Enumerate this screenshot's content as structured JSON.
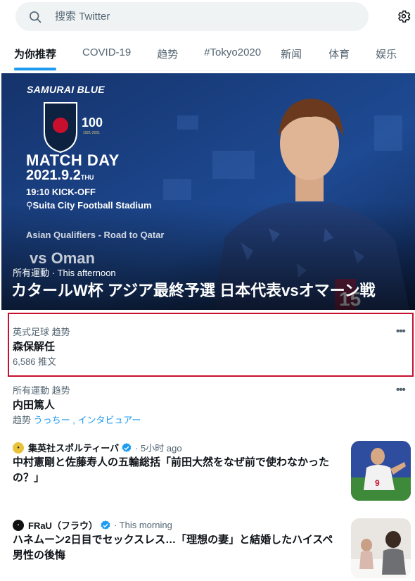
{
  "search": {
    "placeholder": "搜索 Twitter"
  },
  "tabs": [
    {
      "label": "为你推荐",
      "active": true
    },
    {
      "label": "COVID-19"
    },
    {
      "label": "趋势"
    },
    {
      "label": "#Tokyo2020"
    },
    {
      "label": "新闻"
    },
    {
      "label": "体育"
    },
    {
      "label": "娱乐"
    }
  ],
  "hero": {
    "banner": "SAMURAI BLUE",
    "match_day": "MATCH DAY",
    "date": "2021.9.2",
    "date_suffix": "THU",
    "kickoff": "19:10 KICK-OFF",
    "venue": "Suita City Football Stadium",
    "qualifier": "Asian Qualifiers - Road to Qatar",
    "opponent": "vs Oman",
    "anniversary": "100",
    "anniversary_years": "1921-2021",
    "jersey_number": "15",
    "meta": "所有運動 · This afternoon",
    "headline": "カタールW杯 アジア最終予選 日本代表vsオマーン戦"
  },
  "trends": [
    {
      "context": "英式足球 趋势",
      "name": "森保解任",
      "count": "6,586 推文",
      "highlighted": true
    },
    {
      "context": "所有運動 趋势",
      "name": "内田篤人",
      "related_prefix": "趋势",
      "related": "うっちー , インタビュアー"
    }
  ],
  "news": [
    {
      "source": "集英社スポルティーバ",
      "verified": true,
      "time": "· 5小时 ago",
      "title": "中村憲剛と佐藤寿人の五輪総括「前田大然をなぜ前で使わなかったの？」",
      "thumb": "soccer-player-photo",
      "jersey_number": "9"
    },
    {
      "source": "FRaU（フラウ）",
      "verified": true,
      "time": "· This morning",
      "title": "ハネムーン2日目でセックスレス…「理想の妻」と結婚したハイスペ男性の後悔",
      "thumb": "couple-photo"
    }
  ],
  "icons": {
    "search": "search-icon",
    "settings": "gear-icon",
    "more": "more-icon",
    "verified": "verified-badge-icon"
  },
  "colors": {
    "accent": "#1d9bf0",
    "highlight_border": "#c8102e",
    "secondary_text": "#536471"
  }
}
